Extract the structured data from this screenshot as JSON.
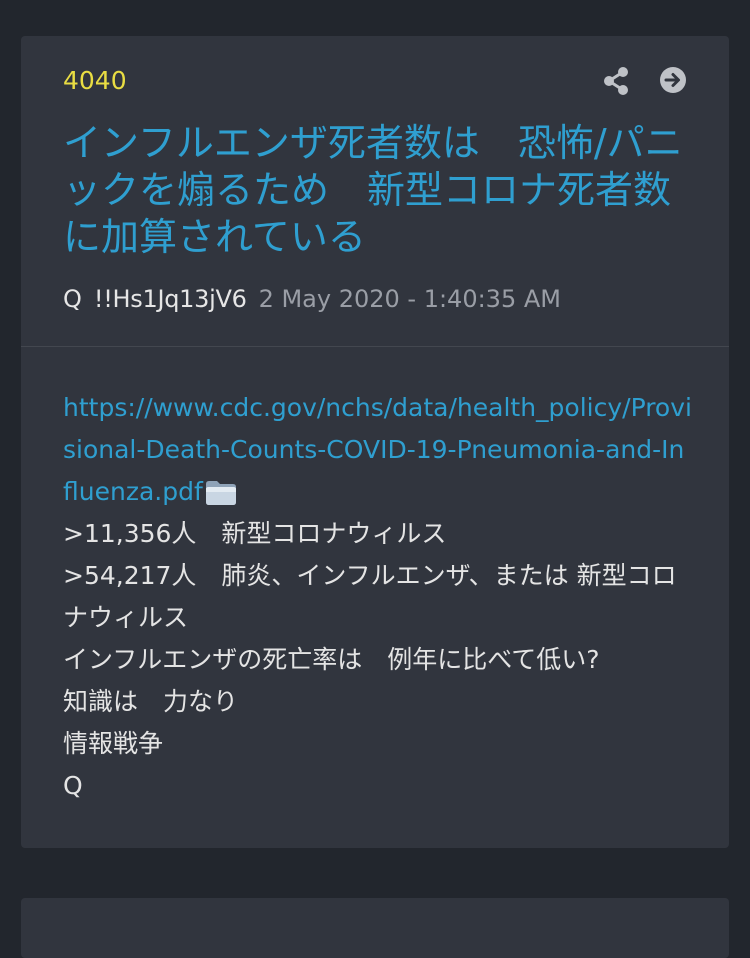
{
  "post": {
    "number": "4040",
    "title": "インフルエンザ死者数は　恐怖/パニックを煽るため　新型コロナ死者数に加算されている",
    "author": "Q",
    "tripcode": "!!Hs1Jq13jV6",
    "timestamp": "2 May 2020 - 1:40:35 AM",
    "link": "https://www.cdc.gov/nchs/data/health_policy/Provisional-Death-Counts-COVID-19-Pneumonia-and-Influenza.pdf",
    "lines": [
      ">11,356人　新型コロナウィルス",
      ">54,217人　肺炎、インフルエンザ、または 新型コロナウィルス",
      "インフルエンザの死亡率は　例年に比べて低い?",
      "知識は　力なり",
      "情報戦争",
      "Q"
    ]
  },
  "icons": {
    "share": "share-icon",
    "go": "arrow-right-circle-icon",
    "file": "folder-icon"
  },
  "colors": {
    "background": "#22262d",
    "card": "#31353e",
    "number": "#e9dd43",
    "accent": "#2f9fd0",
    "text": "#e4e4e4",
    "muted": "#9a9ea6"
  }
}
